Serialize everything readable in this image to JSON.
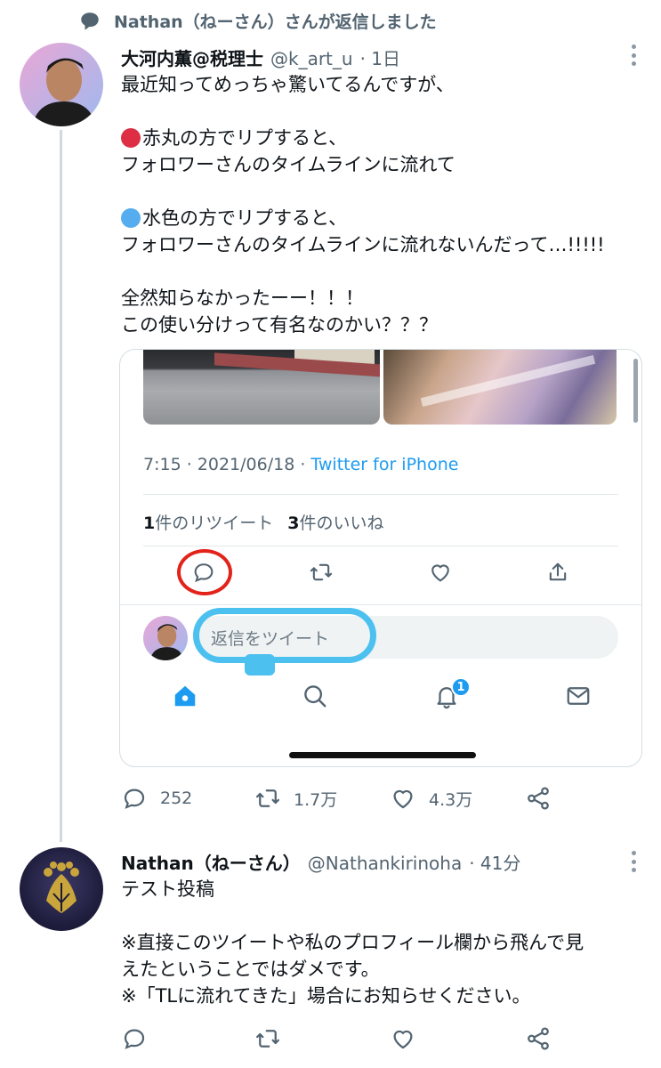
{
  "context": {
    "text": "Nathan（ねーさん）さんが返信しました",
    "icon": "speech-bubble-icon"
  },
  "tweet1": {
    "name": "大河内薫@税理士",
    "handle": "@k_art_u",
    "time": "· 1日",
    "lines": [
      "最近知ってめっちゃ驚いてるんですが、",
      "",
      "赤丸の方でリプすると、",
      "フォロワーさんのタイムラインに流れて",
      "",
      "水色の方でリプすると、",
      "フォロワーさんのタイムラインに流れないんだって…!!!!!",
      "",
      "全然知らなかったーー！！！",
      "この使い分けって有名なのかい？？？"
    ],
    "dot_colors": {
      "red": "#dd2e44",
      "blue": "#55acee"
    },
    "card": {
      "timestamp": "7:15 · 2021/06/18 · ",
      "source": "Twitter for iPhone",
      "retweet_count": "1",
      "retweet_label": "件のリツイート",
      "like_count": "3",
      "like_label": "件のいいね",
      "reply_placeholder": "返信をツイート",
      "notification_badge": "1"
    },
    "stats": {
      "replies": "252",
      "retweets": "1.7万",
      "likes": "4.3万"
    }
  },
  "tweet2": {
    "name": "Nathan（ねーさん）",
    "handle": "@Nathankirinoha",
    "time": "· 41分",
    "lines": [
      "テスト投稿",
      "",
      "※直接このツイートや私のプロフィール欄から飛んで見",
      "えたということではダメです。",
      "※「TLに流れてきた」場合にお知らせください。"
    ]
  },
  "colors": {
    "accent": "#1d9bf0",
    "annotation_red": "#e2231a",
    "annotation_blue": "#4cc0ef"
  }
}
